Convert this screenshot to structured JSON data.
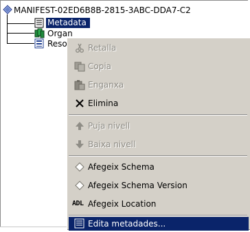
{
  "tree": {
    "root_label": "MANIFEST-02ED6B8B-2815-3ABC-DDA7-C2",
    "children": [
      {
        "label": "Metadata"
      },
      {
        "label": "Organ"
      },
      {
        "label": "Resou"
      }
    ]
  },
  "context_menu": {
    "items": [
      {
        "label": "Retalla",
        "icon": "scissors-icon",
        "enabled": false
      },
      {
        "label": "Copia",
        "icon": "copy-icon",
        "enabled": false
      },
      {
        "label": "Enganxa",
        "icon": "paste-icon",
        "enabled": false
      },
      {
        "label": "Elimina",
        "icon": "delete-x-icon",
        "enabled": true
      },
      {
        "label": "Puja nivell",
        "icon": "arrow-up-icon",
        "enabled": false
      },
      {
        "label": "Baixa nivell",
        "icon": "arrow-down-icon",
        "enabled": false
      },
      {
        "label": "Afegeix Schema",
        "icon": "diamond-icon",
        "enabled": true
      },
      {
        "label": "Afegeix Schema Version",
        "icon": "diamond-icon",
        "enabled": true
      },
      {
        "label": "Afegeix Location",
        "icon_text": "ADL",
        "enabled": true
      },
      {
        "label": "Edita metadades...",
        "icon": "metadata-icon",
        "enabled": true,
        "highlighted": true
      }
    ]
  },
  "colors": {
    "selection": "#0a246a",
    "menu_bg": "#d4d0c8",
    "disabled_text": "#8f8d86"
  }
}
